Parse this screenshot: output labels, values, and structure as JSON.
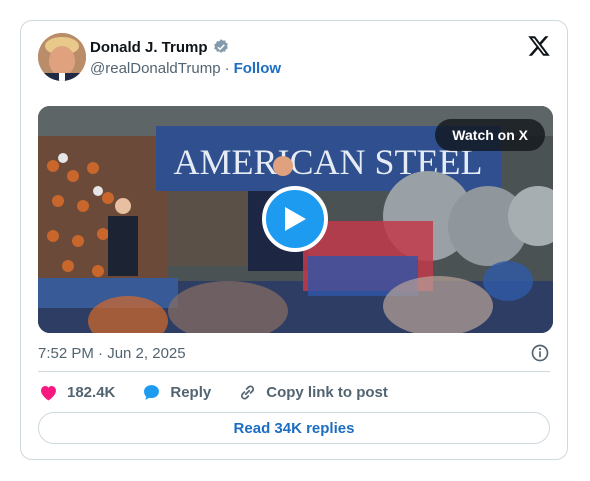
{
  "author": {
    "name": "Donald J. Trump",
    "handle": "@realDonaldTrump",
    "separator": "·",
    "follow_label": "Follow"
  },
  "media": {
    "banner_text": "AMERICAN STEEL",
    "watch_label": "Watch on X"
  },
  "timestamp": "7:52 PM · Jun 2, 2025",
  "actions": {
    "likes": "182.4K",
    "reply_label": "Reply",
    "copy_label": "Copy link to post"
  },
  "read_replies_label": "Read 34K replies",
  "colors": {
    "accent": "#1d9bf0",
    "link": "#1d6ec2",
    "like": "#f91880",
    "muted": "#536471",
    "border": "#cfd9de"
  },
  "icons": {
    "verified": "verified-badge-icon",
    "x_logo": "x-logo-icon",
    "info": "info-icon",
    "heart": "heart-icon",
    "reply": "reply-bubble-icon",
    "link": "link-icon",
    "play": "play-icon"
  }
}
